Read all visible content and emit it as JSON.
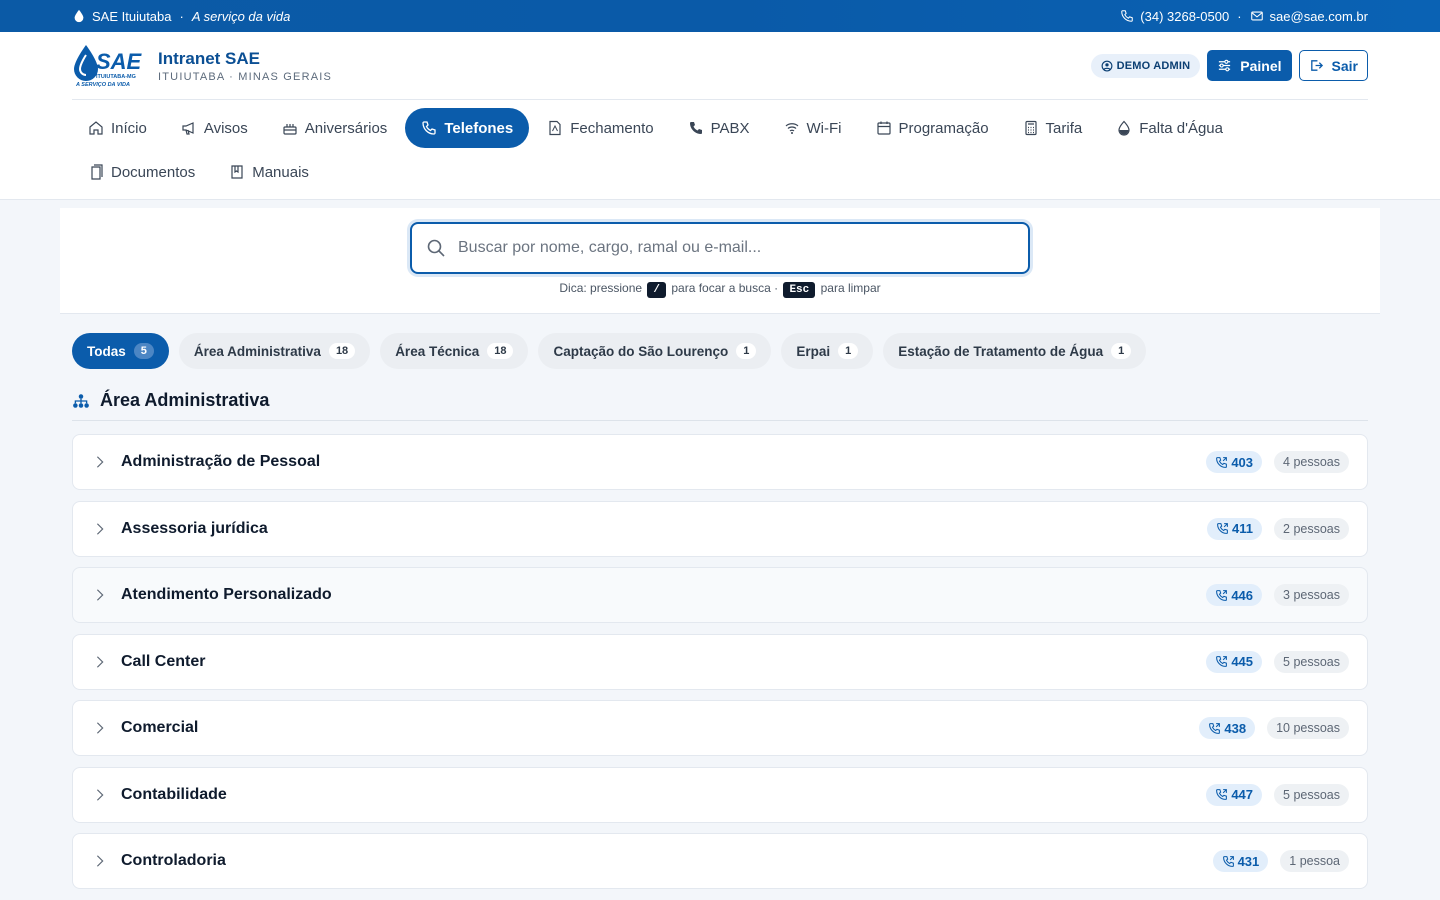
{
  "topbar": {
    "org": "SAE Ituiutaba",
    "separator": "·",
    "tagline": "A serviço da vida",
    "phone": "(34) 3268-0500",
    "email": "sae@sae.com.br"
  },
  "brand": {
    "logo_text": "SAE",
    "logo_sub": "ITUIUTABA-MG",
    "logo_tagline": "A SERVIÇO DA VIDA",
    "title": "Intranet SAE",
    "subtitle": "ITUIUTABA · MINAS GERAIS"
  },
  "header_actions": {
    "user_badge": "DEMO ADMIN",
    "panel_label": "Painel",
    "logout_label": "Sair"
  },
  "nav": {
    "items": [
      {
        "label": "Início",
        "icon": "home-icon"
      },
      {
        "label": "Avisos",
        "icon": "megaphone-icon"
      },
      {
        "label": "Aniversários",
        "icon": "cake-icon"
      },
      {
        "label": "Telefones",
        "icon": "phone-icon",
        "active": true
      },
      {
        "label": "Fechamento",
        "icon": "pdf-icon"
      },
      {
        "label": "PABX",
        "icon": "phone-solid-icon"
      },
      {
        "label": "Wi-Fi",
        "icon": "wifi-icon"
      },
      {
        "label": "Programação",
        "icon": "calendar-icon"
      },
      {
        "label": "Tarifa",
        "icon": "calculator-icon"
      },
      {
        "label": "Falta d'Água",
        "icon": "droplet-icon"
      },
      {
        "label": "Documentos",
        "icon": "documents-icon"
      },
      {
        "label": "Manuais",
        "icon": "book-icon"
      }
    ]
  },
  "search": {
    "placeholder": "Buscar por nome, cargo, ramal ou e-mail...",
    "hint_prefix": "Dica: pressione",
    "key_focus": "/",
    "hint_middle": "para focar a busca ·",
    "key_clear": "Esc",
    "hint_suffix": "para limpar"
  },
  "filters": [
    {
      "label": "Todas",
      "count": "5",
      "active": true
    },
    {
      "label": "Área Administrativa",
      "count": "18"
    },
    {
      "label": "Área Técnica",
      "count": "18"
    },
    {
      "label": "Captação do São Lourenço",
      "count": "1"
    },
    {
      "label": "Erpai",
      "count": "1"
    },
    {
      "label": "Estação de Tratamento de Água",
      "count": "1"
    }
  ],
  "section": {
    "title": "Área Administrativa",
    "departments": [
      {
        "name": "Administração de Pessoal",
        "ramal": "403",
        "people": "4 pessoas"
      },
      {
        "name": "Assessoria jurídica",
        "ramal": "411",
        "people": "2 pessoas"
      },
      {
        "name": "Atendimento Personalizado",
        "ramal": "446",
        "people": "3 pessoas"
      },
      {
        "name": "Call Center",
        "ramal": "445",
        "people": "5 pessoas"
      },
      {
        "name": "Comercial",
        "ramal": "438",
        "people": "10 pessoas"
      },
      {
        "name": "Contabilidade",
        "ramal": "447",
        "people": "5 pessoas"
      },
      {
        "name": "Controladoria",
        "ramal": "431",
        "people": "1 pessoa"
      }
    ]
  },
  "colors": {
    "primary": "#0b5cab",
    "topbar": "#0b5aa6",
    "background": "#f3f6fa"
  }
}
